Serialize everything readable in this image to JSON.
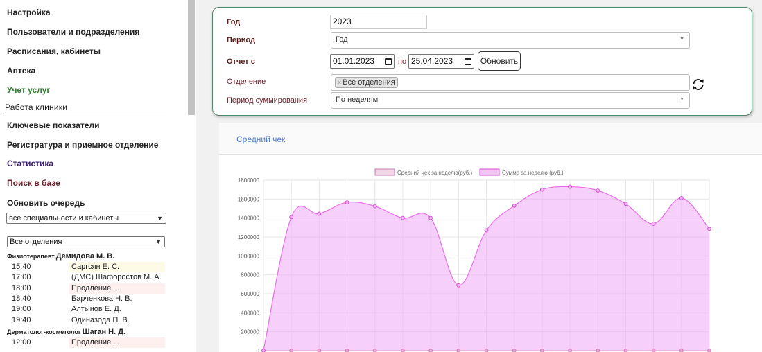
{
  "sidebar": {
    "nav": [
      {
        "label": "Настройка",
        "style": "plain"
      },
      {
        "label": "Пользователи и подразделения",
        "style": "plain"
      },
      {
        "label": "Расписания, кабинеты",
        "style": "plain"
      },
      {
        "label": "Аптека",
        "style": "plain"
      },
      {
        "label": "Учет услуг",
        "style": "green"
      }
    ],
    "section_title": "Работа клиники",
    "clinic_nav": [
      {
        "label": "Ключевые показатели",
        "style": "plain"
      },
      {
        "label": "Регистратура и приемное отделение",
        "style": "plain"
      },
      {
        "label": "Статистика",
        "style": "purple"
      },
      {
        "label": "Поиск в базе",
        "style": "maroon"
      },
      {
        "label": "Обновить очередь",
        "style": "plain"
      }
    ],
    "specialty_select": "все специальности и кабинеты",
    "department_select": "Все отделения",
    "doctors": [
      {
        "spec": "Физиотерапевт",
        "name": "Демидова М. В.",
        "appointments": [
          {
            "time": "15:40",
            "patient": "Саргсян Е. С.",
            "tone": "yellow"
          },
          {
            "time": "17:00",
            "patient": "(ДМС) Шафоростов М. А.",
            "tone": "none"
          },
          {
            "time": "18:00",
            "patient": " Продление . .",
            "tone": "pink"
          },
          {
            "time": "18:40",
            "patient": "Барченкова Н. В.",
            "tone": "none"
          },
          {
            "time": "19:00",
            "patient": "Алтынов Е. Д.",
            "tone": "none"
          },
          {
            "time": "19:40",
            "patient": "Одиназода П. В.",
            "tone": "none"
          }
        ]
      },
      {
        "spec": "Дерматолог-косметолог",
        "name": "Шаган Н. Д.",
        "appointments": [
          {
            "time": "12:00",
            "patient": " Продление . .",
            "tone": "pink"
          }
        ]
      }
    ]
  },
  "filters": {
    "year_label": "Год",
    "year_value": "2023",
    "period_label": "Период",
    "period_value": "Год",
    "report_label": "Отчет с",
    "date_from": "01.01.2023",
    "to_label": "по",
    "date_to": "25.04.2023",
    "refresh_label": "Обновить",
    "department_label": "Отделение",
    "department_tag": "Все отделения",
    "sum_period_label": "Период суммирования",
    "sum_period_value": "По неделям"
  },
  "chart_tab": "Средний чек",
  "chart_data": {
    "type": "area",
    "series": [
      {
        "name": "Средний чек за неделю(руб.)",
        "color": "#e7a9d3",
        "values": [
          0,
          0,
          0,
          0,
          0,
          0,
          0,
          0,
          0,
          0,
          0,
          0,
          0,
          0,
          0,
          0,
          0
        ]
      },
      {
        "name": "Сумма за неделю (руб.)",
        "color": "#e86de8",
        "values": [
          0,
          1410000,
          1445000,
          1565000,
          1525000,
          1400000,
          1400000,
          690000,
          1270000,
          1530000,
          1700000,
          1730000,
          1690000,
          1550000,
          1340000,
          1610000,
          1285000
        ]
      }
    ],
    "y_ticks": [
      "0",
      "200000",
      "400000",
      "600000",
      "800000",
      "1000000",
      "1200000",
      "1400000",
      "1600000",
      "1800000"
    ],
    "ylim": [
      0,
      1800000
    ],
    "legend_position": "top-center",
    "grid": true
  }
}
